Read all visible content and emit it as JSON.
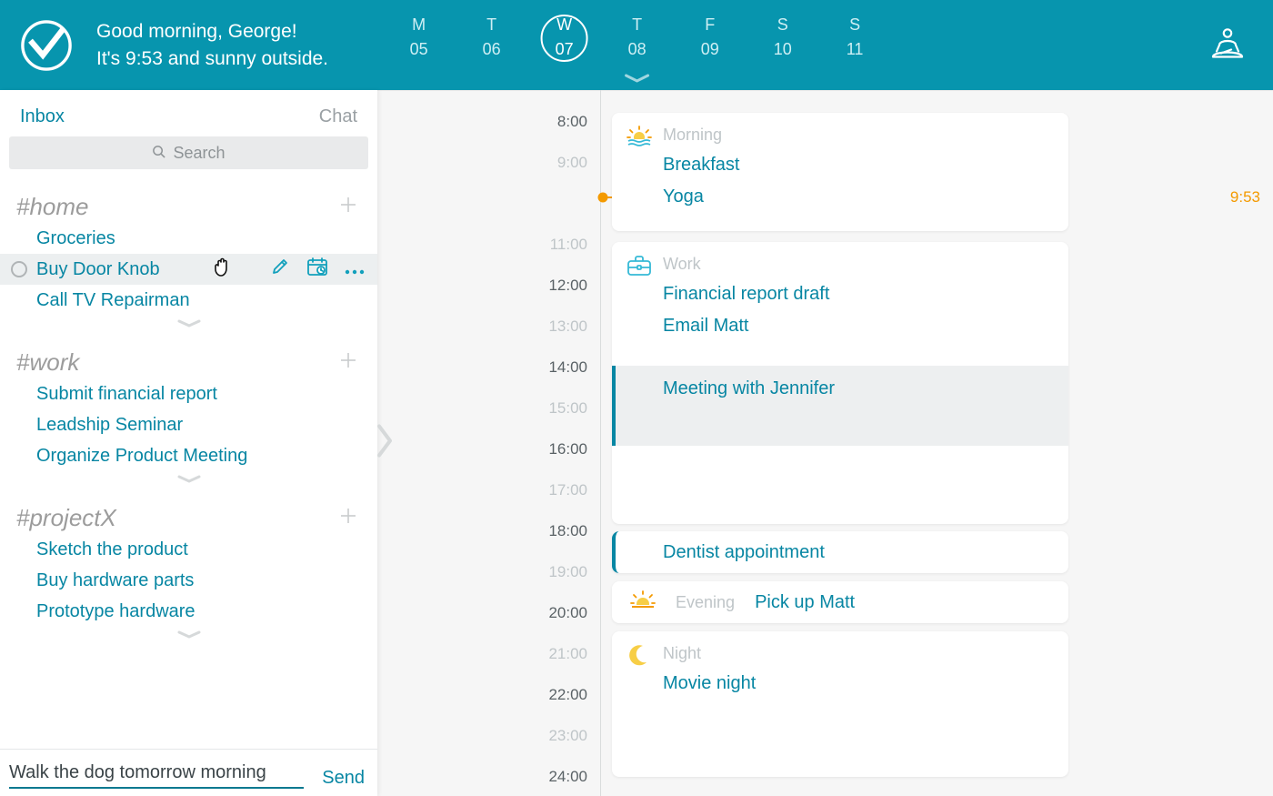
{
  "header": {
    "greeting_line1": "Good morning, George!",
    "greeting_line2": "It's 9:53 and sunny outside.",
    "days": [
      {
        "dow": "M",
        "num": "05",
        "selected": false,
        "chevron": false
      },
      {
        "dow": "T",
        "num": "06",
        "selected": false,
        "chevron": false
      },
      {
        "dow": "W",
        "num": "07",
        "selected": true,
        "chevron": false
      },
      {
        "dow": "T",
        "num": "08",
        "selected": false,
        "chevron": true
      },
      {
        "dow": "F",
        "num": "09",
        "selected": false,
        "chevron": false
      },
      {
        "dow": "S",
        "num": "10",
        "selected": false,
        "chevron": false
      },
      {
        "dow": "S",
        "num": "11",
        "selected": false,
        "chevron": false
      }
    ]
  },
  "sidebar": {
    "tab_inbox": "Inbox",
    "tab_chat": "Chat",
    "search_placeholder": "Search",
    "lists": [
      {
        "name": "#home",
        "tasks": [
          "Groceries",
          "Buy Door Knob",
          "Call TV Repairman"
        ],
        "hover_index": 1
      },
      {
        "name": "#work",
        "tasks": [
          "Submit financial report",
          "Leadship Seminar",
          "Organize Product Meeting"
        ]
      },
      {
        "name": "#projectX",
        "tasks": [
          "Sketch the product",
          "Buy hardware parts",
          "Prototype hardware"
        ]
      }
    ],
    "compose_value": "Walk the dog tomorrow morning",
    "send_label": "Send"
  },
  "timeline": {
    "now_label": "9:53",
    "hours": [
      {
        "label": "8:00",
        "major": true
      },
      {
        "label": "9:00",
        "major": false
      },
      {
        "label": "",
        "major": false
      },
      {
        "label": "11:00",
        "major": false
      },
      {
        "label": "12:00",
        "major": true
      },
      {
        "label": "13:00",
        "major": false
      },
      {
        "label": "14:00",
        "major": true
      },
      {
        "label": "15:00",
        "major": false
      },
      {
        "label": "16:00",
        "major": true
      },
      {
        "label": "17:00",
        "major": false
      },
      {
        "label": "18:00",
        "major": true
      },
      {
        "label": "19:00",
        "major": false
      },
      {
        "label": "20:00",
        "major": true
      },
      {
        "label": "21:00",
        "major": false
      },
      {
        "label": "22:00",
        "major": true
      },
      {
        "label": "23:00",
        "major": false
      },
      {
        "label": "24:00",
        "major": true
      }
    ],
    "sections": {
      "morning": {
        "label": "Morning",
        "items": [
          "Breakfast",
          "Yoga"
        ]
      },
      "work": {
        "label": "Work",
        "items": [
          "Financial report draft",
          "Email Matt"
        ],
        "meeting": "Meeting with Jennifer"
      },
      "appt": {
        "label": "Dentist appointment"
      },
      "evening": {
        "label": "Evening",
        "item": "Pick up Matt"
      },
      "night": {
        "label": "Night",
        "items": [
          "Movie night"
        ]
      }
    }
  },
  "colors": {
    "teal": "#0795AE",
    "link": "#0786A3",
    "orange": "#F49A00",
    "yellow": "#F7CE46"
  }
}
